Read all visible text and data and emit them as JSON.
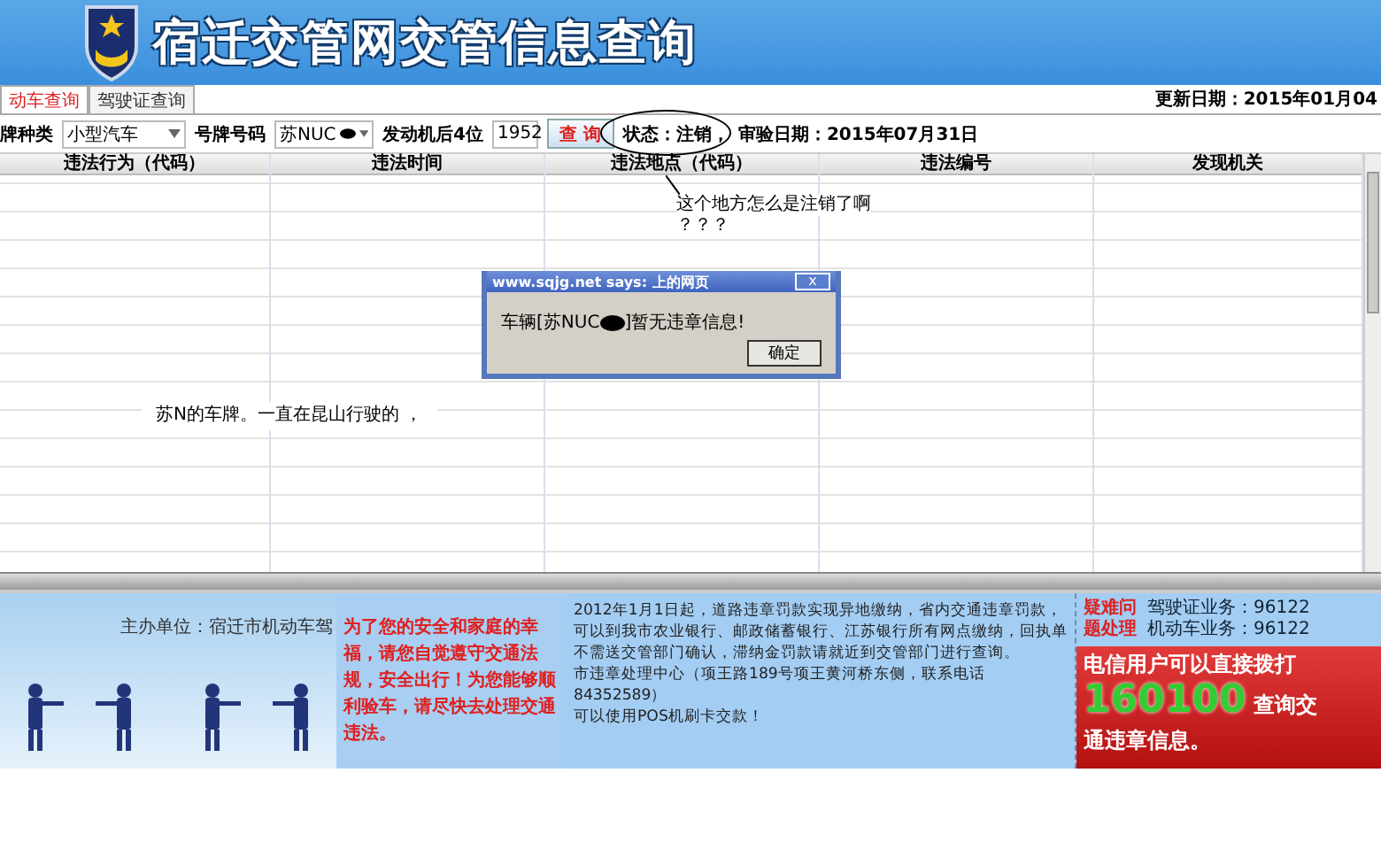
{
  "header": {
    "title": "宿迁交管网交管信息查询"
  },
  "tabs": [
    {
      "label": "动车查询",
      "selected": true
    },
    {
      "label": "驾驶证查询",
      "selected": false
    }
  ],
  "update_date": "更新日期：2015年01月04",
  "filters": {
    "plate_type_label": "牌种类",
    "plate_type": "小型汽车",
    "plate_number_label": "号牌号码",
    "plate_number": "苏NUC",
    "engine_label": "发动机后4位",
    "engine_value": "1952",
    "search_button": "查 询",
    "status": "状态：注销，",
    "inspection_date": "审验日期：2015年07月31日"
  },
  "table": {
    "columns": [
      "违法行为（代码）",
      "违法时间",
      "违法地点（代码）",
      "违法编号",
      "发现机关"
    ]
  },
  "annotations": {
    "question": "这个地方怎么是注销了啊",
    "question_marks": "？？？",
    "note": "苏N的车牌。一直在昆山行驶的 ，"
  },
  "dialog": {
    "title": "www.sqjg.net says: 上的网页",
    "close": "x",
    "message_before": "车辆[苏NUC",
    "message_after": "]暂无违章信息!",
    "ok": "确定"
  },
  "footer": {
    "sponsor": "主办单位：宿迁市机动车驾",
    "slogan": "为了您的安全和家庭的幸福，请您自觉遵守交通法规，安全出行！为您能够顺利验车，请尽快去处理交通违法。",
    "notice": [
      "2012年1月1日起，道路违章罚款实现异地缴纳，省内交通违章罚款，可以到我市农业银行、邮政储蓄银行、江苏银行所有网点缴纳，回执单不需送交管部门确认，滞纳金罚款请就近到交管部门进行查询。",
      "市违章处理中心（项王路189号项王黄河桥东侧，联系电话84352589）",
      "可以使用POS机刷卡交款！"
    ],
    "help_label": [
      "疑难问",
      "题处理"
    ],
    "hotlines": [
      "驾驶证业务：96122",
      "机动车业务：96122"
    ],
    "promo": [
      "电信用户可以直接拨打",
      "160100",
      "查询交",
      "通违章信息。"
    ]
  }
}
